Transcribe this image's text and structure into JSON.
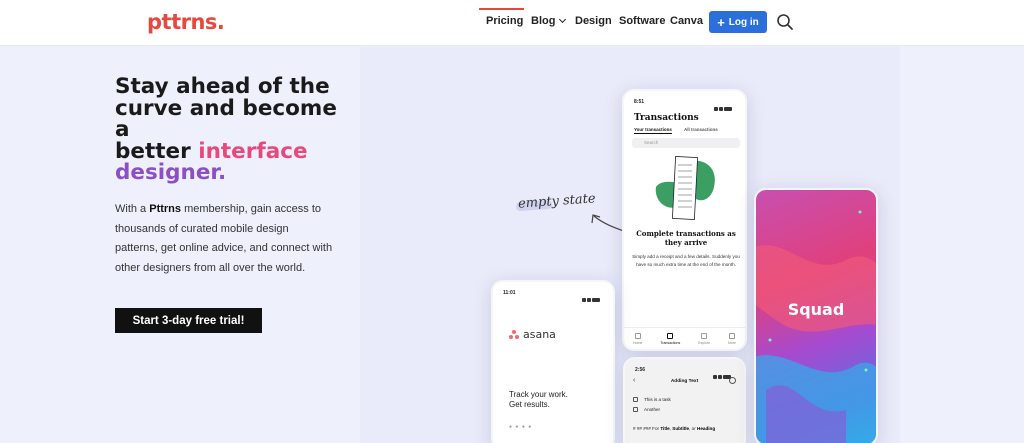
{
  "header": {
    "logo": "pttrns.",
    "nav": [
      {
        "label": "Pricing",
        "active": true
      },
      {
        "label": "Blog",
        "has_dropdown": true
      },
      {
        "label": "Design"
      },
      {
        "label": "Software"
      },
      {
        "label": "Canva"
      }
    ],
    "login_label": "Log in",
    "search_icon": "search-icon"
  },
  "hero": {
    "headline_line1": "Stay ahead of the",
    "headline_line2": "curve and become a",
    "headline_line3a": "better ",
    "headline_line3b": "interface",
    "headline_line4": "designer.",
    "body_pre": "With a ",
    "body_brand": "Pttrns",
    "body_post": " membership, gain access to thousands of curated mobile design patterns, get online advice, and connect with other designers from all over the world.",
    "cta_label": "Start 3-day free trial!"
  },
  "annotation": "empty state",
  "phones": {
    "transactions": {
      "time": "8:51",
      "title": "Transactions",
      "tab_active": "Your transactions",
      "tab_other": "All transactions",
      "search_placeholder": "Search",
      "heading": "Complete transactions as they arrive",
      "body": "Simply add a receipt and a few details. Suddenly you have so much extra time at the end of the month.",
      "nav": [
        "Home",
        "Transactions",
        "Explore",
        "More"
      ]
    },
    "asana": {
      "time": "11:01",
      "logo": "asana",
      "tagline_line1": "Track your work.",
      "tagline_line2": "Get results.",
      "pager": "● ● ● ●"
    },
    "tasks": {
      "time": "2:56",
      "title": "Adding Text",
      "items": [
        "This is a task",
        "Another"
      ],
      "md_prefix": "# ## ### For ",
      "md_bold1": "Title",
      "md_sep1": ", ",
      "md_bold2": "Subtitle",
      "md_sep2": ", or ",
      "md_bold3": "Heading"
    },
    "squad": {
      "label": "Squad"
    }
  },
  "colors": {
    "brand": "#e6483d",
    "login": "#2a6fdb",
    "headline_pink": "#e64a7c",
    "headline_purple": "#8b4fc6"
  }
}
